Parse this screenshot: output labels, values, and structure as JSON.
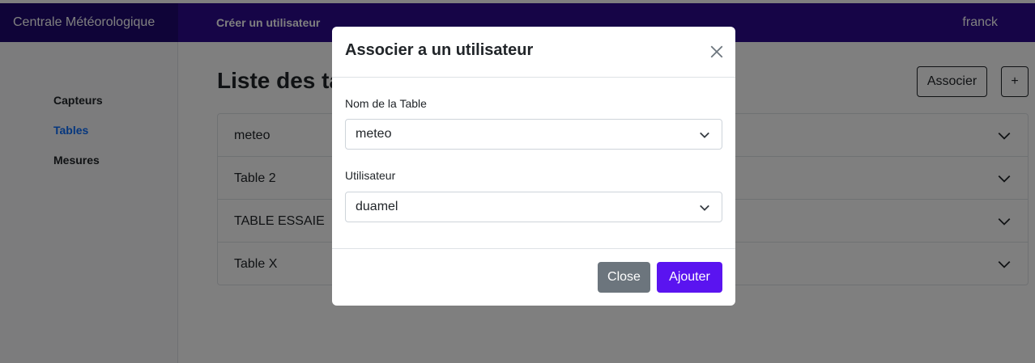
{
  "navbar": {
    "brand": "Centrale Météorologique",
    "create_user_link": "Créer un utilisateur",
    "username": "franck"
  },
  "sidebar": {
    "items": [
      {
        "label": "Capteurs",
        "active": false
      },
      {
        "label": "Tables",
        "active": true
      },
      {
        "label": "Mesures",
        "active": false
      }
    ]
  },
  "main": {
    "title": "Liste des tables",
    "associate_label": "Associer",
    "add_label": "+",
    "tables": [
      {
        "label": "meteo"
      },
      {
        "label": "Table 2"
      },
      {
        "label": "TABLE ESSAIE"
      },
      {
        "label": "Table X"
      }
    ]
  },
  "modal": {
    "title": "Associer a un utilisateur",
    "table_label": "Nom de la Table",
    "table_value": "meteo",
    "user_label": "Utilisateur",
    "user_value": "duamel",
    "close_label": "Close",
    "add_label": "Ajouter"
  },
  "colors": {
    "navbar": "#2c0b8f",
    "primary_button": "#5a14f0",
    "secondary_button": "#6c757d"
  }
}
